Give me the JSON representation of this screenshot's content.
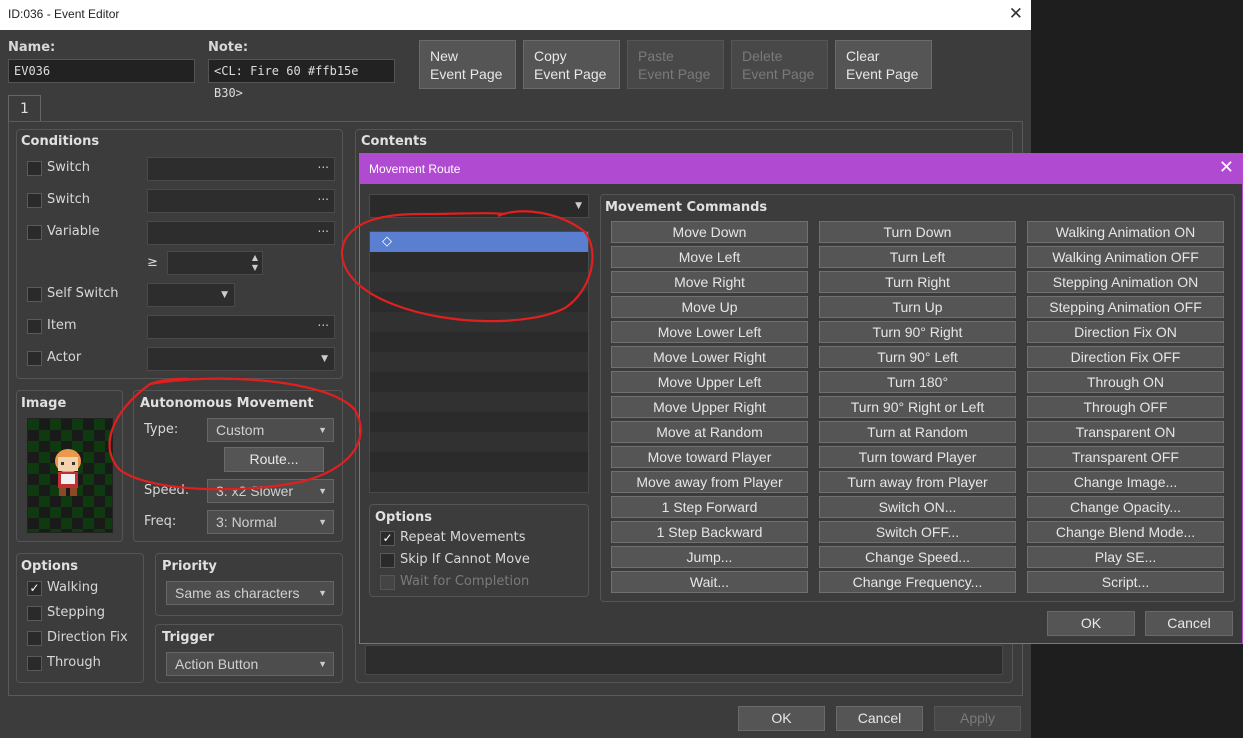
{
  "editor": {
    "title": "ID:036 - Event Editor",
    "name_label": "Name:",
    "name_value": "EV036",
    "note_label": "Note:",
    "note_value": "<CL: Fire 60 #ffb15e B30>",
    "page_buttons": [
      "New\nEvent Page",
      "Copy\nEvent Page",
      "Paste\nEvent Page",
      "Delete\nEvent Page",
      "Clear\nEvent Page"
    ],
    "page_tab": "1",
    "conditions": {
      "title": "Conditions",
      "switch1": "Switch",
      "switch2": "Switch",
      "variable": "Variable",
      "gte": "≥",
      "self_switch": "Self Switch",
      "item": "Item",
      "actor": "Actor",
      "ellipsis": "..."
    },
    "image_title": "Image",
    "autonomous": {
      "title": "Autonomous Movement",
      "type_label": "Type:",
      "type_value": "Custom",
      "route_button": "Route...",
      "speed_label": "Speed:",
      "speed_value": "3: x2 Slower",
      "freq_label": "Freq:",
      "freq_value": "3: Normal"
    },
    "options": {
      "title": "Options",
      "walking": "Walking",
      "stepping": "Stepping",
      "direction_fix": "Direction Fix",
      "through": "Through",
      "check_mark": "✓"
    },
    "priority": {
      "title": "Priority",
      "value": "Same as characters"
    },
    "trigger": {
      "title": "Trigger",
      "value": "Action Button"
    },
    "contents_title": "Contents",
    "footer": {
      "ok": "OK",
      "cancel": "Cancel",
      "apply": "Apply"
    }
  },
  "movement_route": {
    "title": "Movement Route",
    "close": "✕",
    "first_row_marker": "◇",
    "commands_title": "Movement Commands",
    "col1": [
      "Move Down",
      "Move Left",
      "Move Right",
      "Move Up",
      "Move Lower Left",
      "Move Lower Right",
      "Move Upper Left",
      "Move Upper Right",
      "Move at Random",
      "Move toward Player",
      "Move away from Player",
      "1 Step Forward",
      "1 Step Backward",
      "Jump...",
      "Wait..."
    ],
    "col2": [
      "Turn Down",
      "Turn Left",
      "Turn Right",
      "Turn Up",
      "Turn 90° Right",
      "Turn 90° Left",
      "Turn 180°",
      "Turn 90° Right or Left",
      "Turn at Random",
      "Turn toward Player",
      "Turn away from Player",
      "Switch ON...",
      "Switch OFF...",
      "Change Speed...",
      "Change Frequency..."
    ],
    "col3": [
      "Walking Animation ON",
      "Walking Animation OFF",
      "Stepping Animation ON",
      "Stepping Animation OFF",
      "Direction Fix ON",
      "Direction Fix OFF",
      "Through ON",
      "Through OFF",
      "Transparent ON",
      "Transparent OFF",
      "Change Image...",
      "Change Opacity...",
      "Change Blend Mode...",
      "Play SE...",
      "Script..."
    ],
    "options": {
      "title": "Options",
      "repeat": "Repeat Movements",
      "skip": "Skip If Cannot Move",
      "wait": "Wait for Completion",
      "check_mark": "✓"
    },
    "ok": "OK",
    "cancel": "Cancel"
  },
  "colors": {
    "dialog_accent": "#b04ad0",
    "selection": "#5a7fd0",
    "annotation": "#e02020"
  }
}
